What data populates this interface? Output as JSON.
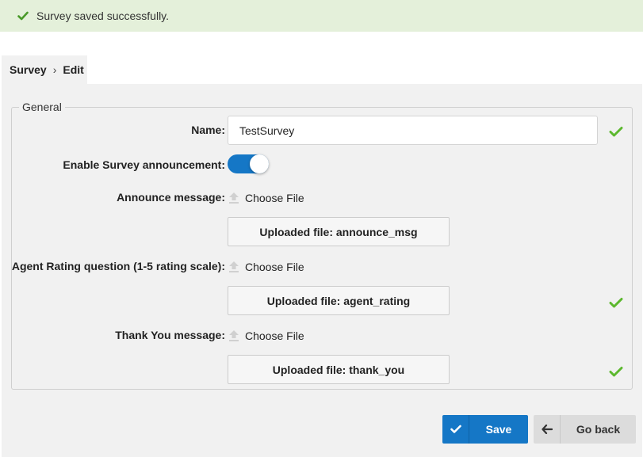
{
  "alert": {
    "message": "Survey saved successfully.",
    "icon": "check-icon",
    "color": "#e4f0da"
  },
  "breadcrumb": {
    "root": "Survey",
    "current": "Edit"
  },
  "form": {
    "legend": "General",
    "name": {
      "label": "Name:",
      "value": "TestSurvey"
    },
    "announcement_toggle": {
      "label": "Enable Survey announcement:",
      "on": true
    },
    "announce": {
      "label": "Announce message:",
      "choose": "Choose File",
      "uploaded": "Uploaded file: announce_msg"
    },
    "agent_rating": {
      "label": "Agent Rating question (1-5 rating scale):",
      "choose": "Choose File",
      "uploaded": "Uploaded file: agent_rating"
    },
    "thank_you": {
      "label": "Thank You message:",
      "choose": "Choose File",
      "uploaded": "Uploaded file: thank_you"
    }
  },
  "buttons": {
    "save": "Save",
    "go_back": "Go back"
  },
  "colors": {
    "accent": "#1577c6",
    "valid": "#5cb82e"
  }
}
